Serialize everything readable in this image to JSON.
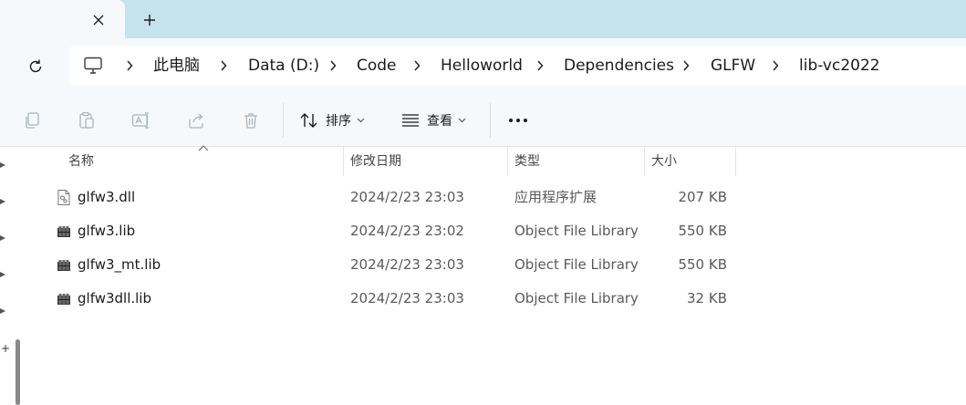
{
  "tabs": {
    "close_glyph": "✕",
    "new_tab_glyph": "+"
  },
  "breadcrumb": {
    "separator": "›",
    "items": [
      {
        "label": "此电脑"
      },
      {
        "label": "Data (D:)"
      },
      {
        "label": "Code"
      },
      {
        "label": "Helloworld"
      },
      {
        "label": "Dependencies"
      },
      {
        "label": "GLFW"
      },
      {
        "label": "lib-vc2022"
      }
    ]
  },
  "toolbar": {
    "icons": [
      "copy-icon",
      "paste-icon",
      "rename-icon",
      "share-icon",
      "delete-icon"
    ],
    "sort_label": "排序",
    "view_label": "查看",
    "more_glyph": "•••"
  },
  "columns": {
    "name": "名称",
    "date": "修改日期",
    "type": "类型",
    "size": "大小"
  },
  "files": [
    {
      "name": "glfw3.dll",
      "date": "2024/2/23 23:03",
      "type": "应用程序扩展",
      "size": "207 KB",
      "icon": "dll-file-icon"
    },
    {
      "name": "glfw3.lib",
      "date": "2024/2/23 23:02",
      "type": "Object File Library",
      "size": "550 KB",
      "icon": "lib-file-icon"
    },
    {
      "name": "glfw3_mt.lib",
      "date": "2024/2/23 23:03",
      "type": "Object File Library",
      "size": "550 KB",
      "icon": "lib-file-icon"
    },
    {
      "name": "glfw3dll.lib",
      "date": "2024/2/23 23:03",
      "type": "Object File Library",
      "size": "32 KB",
      "icon": "lib-file-icon"
    }
  ],
  "nav": {
    "expand_glyph": "+"
  },
  "colors": {
    "tabstrip": "#c5e3ec",
    "chrome": "#f5f9fb",
    "text": "#1b1b1b",
    "secondary_text": "#5a5a5a"
  }
}
